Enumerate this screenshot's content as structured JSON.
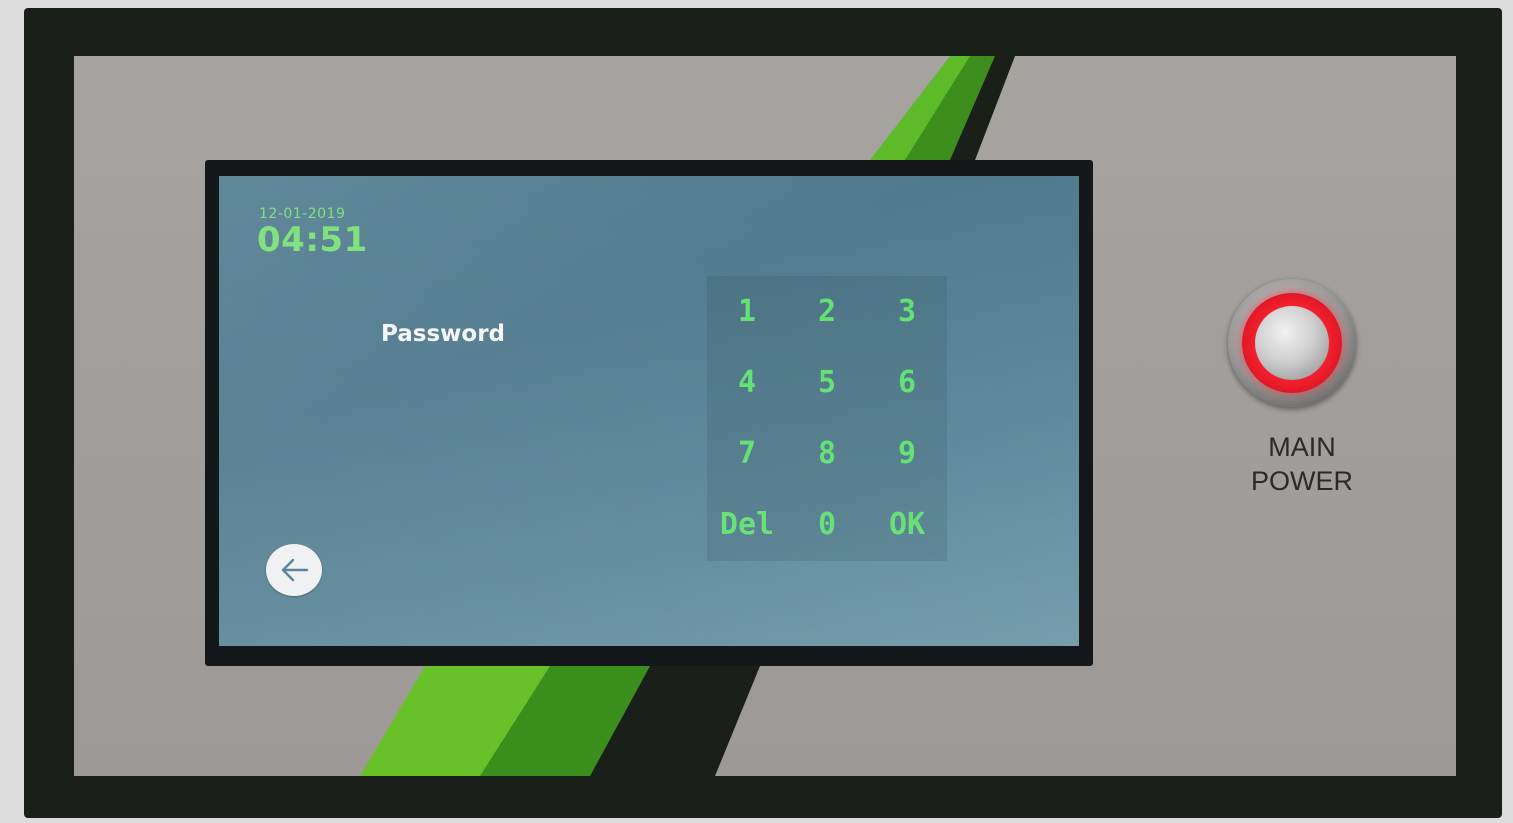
{
  "screen": {
    "date": "12-01-2019",
    "time": "04:51",
    "password_label": "Password",
    "keypad": {
      "keys": [
        "1",
        "2",
        "3",
        "4",
        "5",
        "6",
        "7",
        "8",
        "9",
        "Del",
        "0",
        "OK"
      ]
    },
    "back_icon": "arrow-left-icon"
  },
  "panel": {
    "power_label_line1": "MAIN",
    "power_label_line2": "POWER"
  },
  "colors": {
    "accent_green": "#5fe070",
    "screen_blue": "#4f798c",
    "power_ring_red": "#ee1c2a"
  }
}
